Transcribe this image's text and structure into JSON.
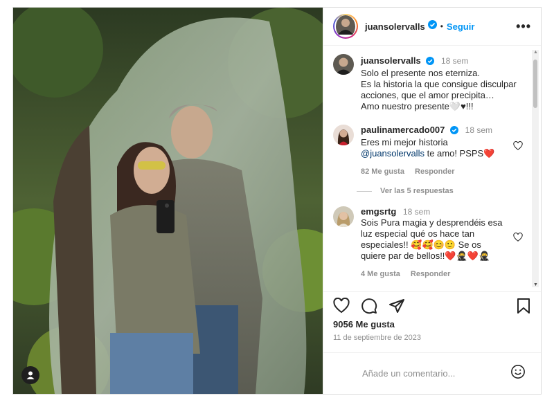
{
  "post": {
    "username": "juansolervalls",
    "follow_label": "Seguir",
    "more_label": "•••"
  },
  "caption": {
    "username": "juansolervalls",
    "time": "18 sem",
    "lines": [
      "Solo el presente nos eterniza.",
      "Es la historia la que consigue disculpar",
      "acciones, que el amor precipita…",
      "Amo nuestro presente🤍♥!!!"
    ]
  },
  "comments": [
    {
      "username": "paulinamercado007",
      "verified": true,
      "time": "18 sem",
      "line1": "Eres mi mejor historia",
      "mention": "@juansolervalls",
      "line2_rest": " te amo! PSPS❤️",
      "likes": "82 Me gusta",
      "reply_label": "Responder",
      "view_replies": "Ver las 5 respuestas"
    },
    {
      "username": "emgsrtg",
      "time": "18 sem",
      "lines": [
        "Sois Pura magia y desprendéis esa",
        "luz especial qué os hace tan",
        "especiales!! 🥰🥰😊🙂 Se os",
        "quiere par de bellos!!❤️🥷❤️🥷"
      ],
      "likes": "4 Me gusta",
      "reply_label": "Responder"
    }
  ],
  "stats": {
    "likes": "9056 Me gusta",
    "date": "11 de septiembre de 2023"
  },
  "add_comment": {
    "placeholder": "Añade un comentario..."
  },
  "colors": {
    "accent": "#0095f6",
    "verified": "#0095f6",
    "heart_red": "#ed4956"
  }
}
